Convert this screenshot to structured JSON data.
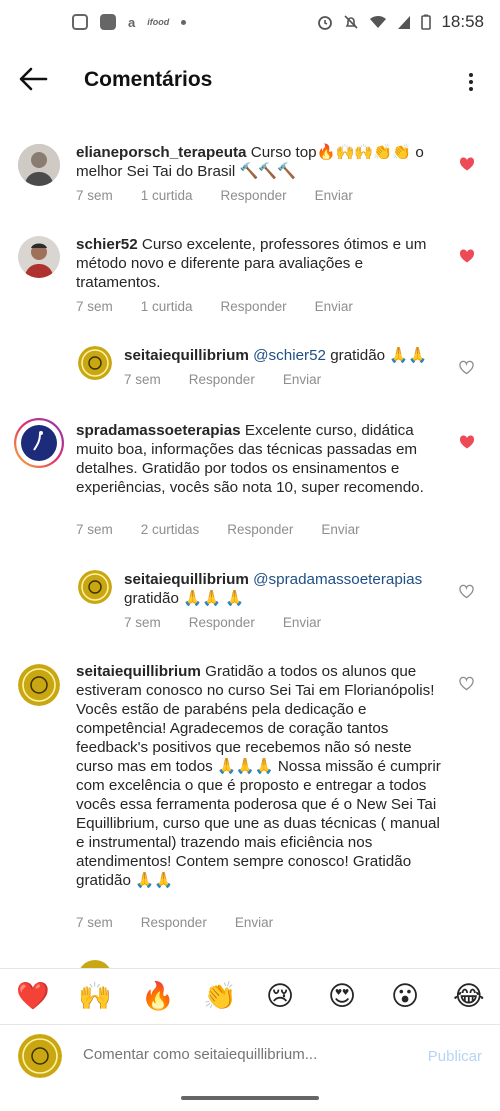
{
  "status": {
    "time": "18:58",
    "app_icons": [
      "instagram-icon",
      "gallery-icon",
      "amazon-icon",
      "ifood-icon"
    ],
    "ifood_label": "ifood",
    "amazon_label": "a"
  },
  "header": {
    "title": "Comentários"
  },
  "comments": [
    {
      "username": "elianeporsch_terapeuta",
      "text": "Curso top🔥🙌🙌👏👏 o melhor Sei Tai do Brasil 🔨🔨🔨",
      "time": "7 sem",
      "likes": "1 curtida",
      "reply": "Responder",
      "send": "Enviar",
      "liked": true
    },
    {
      "username": "schier52",
      "text": "Curso excelente, professores ótimos e um método novo e diferente para avaliações e tratamentos.",
      "time": "7 sem",
      "likes": "1 curtida",
      "reply": "Responder",
      "send": "Enviar",
      "liked": true
    },
    {
      "username": "seitaiequillibrium",
      "mention": "@schier52",
      "text": "gratidão 🙏🙏",
      "time": "7 sem",
      "reply": "Responder",
      "send": "Enviar",
      "liked": false
    },
    {
      "username": "spradamassoeterapias",
      "text": "Excelente curso, didática muito boa, informações das técnicas passadas em detalhes. Gratidão por todos os ensinamentos e experiências, vocês são nota 10, super recomendo.",
      "time": "7 sem",
      "likes": "2 curtidas",
      "reply": "Responder",
      "send": "Enviar",
      "liked": true
    },
    {
      "username": "seitaiequillibrium",
      "mention": "@spradamassoeterapias",
      "text": "gratidão 🙏🙏 🙏",
      "time": "7 sem",
      "reply": "Responder",
      "send": "Enviar",
      "liked": false
    },
    {
      "username": "seitaiequillibrium",
      "text": "Gratidão a todos os alunos que estiveram conosco no curso Sei Tai em Florianópolis! Vocês estão de parabéns pela dedicação e competência! Agradecemos de coração tantos feedback's positivos que recebemos não só neste curso mas em todos 🙏🙏🙏 Nossa missão é cumprir com excelência o que é proposto e entregar a todos vocês essa ferramenta poderosa que é o New Sei Tai Equillibrium, curso que une as duas técnicas ( manual e instrumental) trazendo mais eficiência nos atendimentos! Contem sempre conosco! Gratidão gratidão 🙏🙏",
      "time": "7 sem",
      "reply": "Responder",
      "send": "Enviar",
      "liked": false
    }
  ],
  "reactions": [
    "❤️",
    "🙌",
    "🔥",
    "👏",
    "😢",
    "😍",
    "😮",
    "😂"
  ],
  "composer": {
    "placeholder": "Comentar como seitaiequillibrium...",
    "publish_label": "Publicar"
  },
  "colors": {
    "liked_heart": "#ed4956",
    "publish_disabled": "#b6d4f5",
    "mention": "#1f4f86"
  }
}
